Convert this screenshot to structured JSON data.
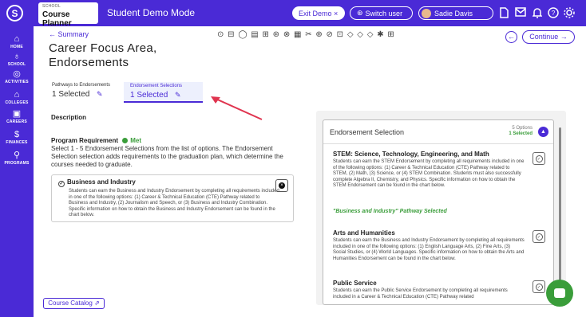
{
  "colors": {
    "brand": "#4a2ad6",
    "success": "#3a9d3a"
  },
  "topbar": {
    "logo_icon": "S",
    "app_small_label": "SCHOOL",
    "app_name": "Course Planner",
    "mode_title": "Student Demo Mode",
    "exit_demo": "Exit Demo ×",
    "switch_user": "Switch user",
    "user_name": "Sadie Davis",
    "icons": [
      "document-icon",
      "mail-icon",
      "bell-icon",
      "help-icon",
      "gear-icon"
    ]
  },
  "sidebar": {
    "items": [
      {
        "label": "HOME",
        "icon": "⌂"
      },
      {
        "label": "SCHOOL",
        "icon": "♁"
      },
      {
        "label": "ACTIVITIES",
        "icon": "◎"
      },
      {
        "label": "COLLEGES",
        "icon": "⌂"
      },
      {
        "label": "CAREERS",
        "icon": "▣"
      },
      {
        "label": "FINANCES",
        "icon": "$"
      },
      {
        "label": "PROGRAMS",
        "icon": "⚲"
      }
    ]
  },
  "main": {
    "back_link": "← Summary",
    "title": "Career Focus Area, Endorsements",
    "toolbar_icons": "⊙ ⊟ ◯ ▤ ⊞ ⊛ ⊗ ▦ ✂ ⊕ ⊘ ⊡ ◇ ◇ ◇ ✱ ⊞",
    "continue_label": "Continue →",
    "tabs": [
      {
        "label": "Pathways to Endorsements",
        "value": "1 Selected"
      },
      {
        "label": "Endorsement Selections",
        "value": "1 Selected"
      }
    ],
    "description_heading": "Description",
    "program_requirement": "Program Requirement",
    "met_label": "Met",
    "requirement_text": "Select 1 - 5 Endorsement Selections from the list of options. The Endorsement Selection selection adds requirements to the graduation plan, which determine the courses needed to graduate.",
    "option_card": {
      "title": "Business and Industry",
      "text": "Students can earn the Business and Industry Endorsement by completing all requirements included in one of the following options: (1) Career & Technical Education (CTE) Pathway related to Business and Industry, (2) Journalism and Speech, or (3) Business and Industry Combination. Specific information on how to obtain the Business and Industry Endorsement can be found in the chart below."
    },
    "catalog_button": "Course Catalog"
  },
  "panel": {
    "title": "Endorsement Selection",
    "options_count": "5 Options",
    "selected_count": "1 Selected",
    "items": [
      {
        "title": "STEM: Science, Technology, Engineering, and Math",
        "text": "Students can earn the STEM Endorsement by completing all requirements included in one of the following options: (1) Career & Technical Education (CTE) Pathway related to STEM, (2) Math, (3) Science, or (4) STEM Combination. Students must also successfully complete Algebra II, Chemistry, and Physics. Specific information on how to obtain the STEM Endorsement can be found in the chart below."
      },
      {
        "title": "Arts and Humanities",
        "text": "Students can earn the Business and Industry Endorsement by completing all requirements included in one of the following options: (1) English Language Arts, (2) Fine Arts, (3) Social Studies, or (4) World Languages. Specific information on how to obtain the Arts and Humanities Endorsement can be found in the chart below."
      },
      {
        "title": "Public Service",
        "text": "Students can earn the Public Service Endorsement by completing all requirements included in a Career & Technical Education (CTE) Pathway related"
      }
    ],
    "selected_pathway": "\"Business and Industry\" Pathway Selected"
  }
}
